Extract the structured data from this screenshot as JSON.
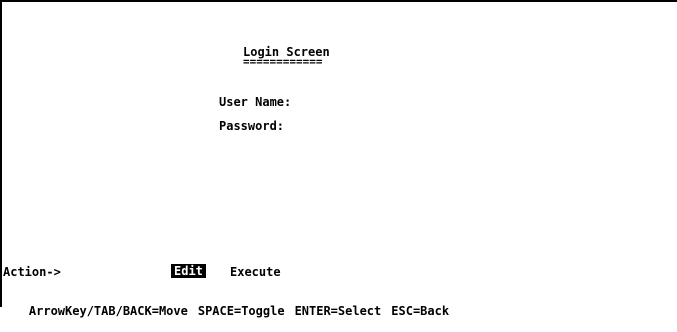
{
  "screen": {
    "title": "Login Screen",
    "title_underline": "============"
  },
  "form": {
    "username_label": "User Name:",
    "password_label": "Password:"
  },
  "action_bar": {
    "label": "Action->",
    "edit_label": "Edit",
    "execute_label": "Execute"
  },
  "help_bar": {
    "move": "ArrowKey/TAB/BACK=Move",
    "toggle": "SPACE=Toggle",
    "select": "ENTER=Select",
    "back": "ESC=Back"
  },
  "colors": {
    "background": "#ffffff",
    "text": "#000000",
    "highlight_bg": "#000000",
    "highlight_text": "#ffffff"
  }
}
